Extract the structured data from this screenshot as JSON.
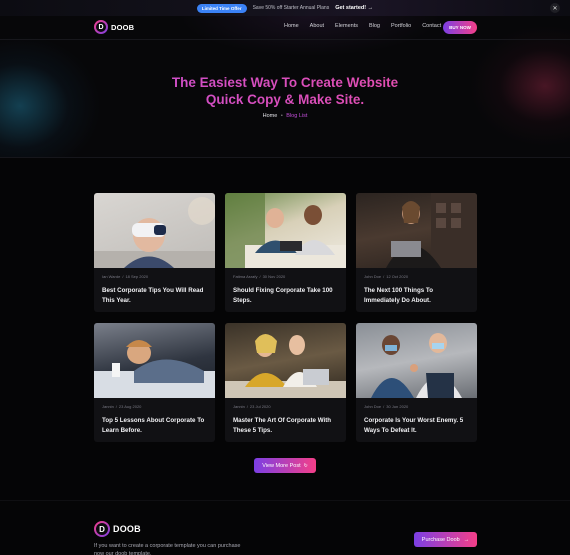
{
  "announcement": {
    "badge": "Limited Time Offer",
    "text": "Save 50% off Starter Annual Plans",
    "cta": "Get started!",
    "cta_icon": "arrow-right-icon",
    "close_icon": "close-icon"
  },
  "nav": {
    "logo_letter": "D",
    "logo_text": "DOOB",
    "menu": [
      "Home",
      "About",
      "Elements",
      "Blog",
      "Portfolio",
      "Contact"
    ],
    "buy_label": "BUY NOW"
  },
  "hero": {
    "title_line1": "The Easiest Way To Create Website",
    "title_line2": "Quick Copy & Make Site.",
    "breadcrumb_home": "Home",
    "breadcrumb_sep": "•",
    "breadcrumb_current": "Blog List"
  },
  "posts": [
    {
      "author": "Ian Warde",
      "date": "18 Sep 2020",
      "title": "Best Corporate Tips You Will Read This Year."
    },
    {
      "author": "Fatima Asrafy",
      "date": "30 Nov 2020",
      "title": "Should Fixing Corporate Take 100 Steps."
    },
    {
      "author": "John Doe",
      "date": "12 Oct 2020",
      "title": "The Next 100 Things To Immediately Do About."
    },
    {
      "author": "Jannin",
      "date": "23 Aug 2020",
      "title": "Top 5 Lessons About Corporate To Learn Before."
    },
    {
      "author": "Jannin",
      "date": "23 Jul 2020",
      "title": "Master The Art Of Corporate With These 5 Tips."
    },
    {
      "author": "John Doe",
      "date": "30 Jun 2020",
      "title": "Corporate Is Your Worst Enemy. 5 Ways To Defeat It."
    }
  ],
  "view_more": {
    "label": "View More Post",
    "icon": "refresh-icon"
  },
  "footer": {
    "logo_letter": "D",
    "logo_text": "DOOB",
    "text": "If you want to create a corporate template you can purchase now our doob template.",
    "purchase_label": "Purchase Doob",
    "purchase_icon": "arrow-right-icon"
  },
  "colors": {
    "accent_start": "#7b3fe4",
    "accent_end": "#f43f88",
    "background": "#050506",
    "card": "#111114",
    "badge_blue": "#3b82f6"
  }
}
